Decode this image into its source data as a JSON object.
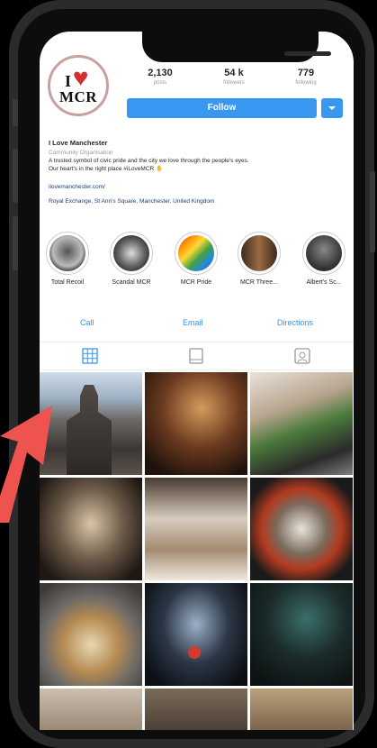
{
  "profile": {
    "avatar_text": "MCR",
    "name": "I Love Manchester",
    "category": "Community Organisation",
    "bio_line1": "A trusted symbol of civic pride and the city we love through the people's eyes.",
    "bio_line2": "Our heart's in the right place #iLoveMCR",
    "website": "ilovemanchester.com/",
    "address": "Royal Exchange, St Ann's Square, Manchester, United Kingdom"
  },
  "stats": {
    "posts_value": "2,130",
    "posts_label": "posts",
    "followers_value": "54 k",
    "followers_label": "followers",
    "following_value": "779",
    "following_label": "following"
  },
  "follow_label": "Follow",
  "highlights": [
    {
      "label": "Total Recoil"
    },
    {
      "label": "Scandal MCR"
    },
    {
      "label": "MCR Pride"
    },
    {
      "label": "MCR Three..."
    },
    {
      "label": "Albert's Sc..."
    }
  ],
  "actions": {
    "call": "Call",
    "email": "Email",
    "directions": "Directions"
  },
  "tabs": [
    "grid-icon",
    "tagged-feed-icon",
    "tagged-photos-icon"
  ],
  "colors": {
    "accent": "#3897f0",
    "arrow": "#ef5350",
    "heart": "#d32f2f"
  }
}
